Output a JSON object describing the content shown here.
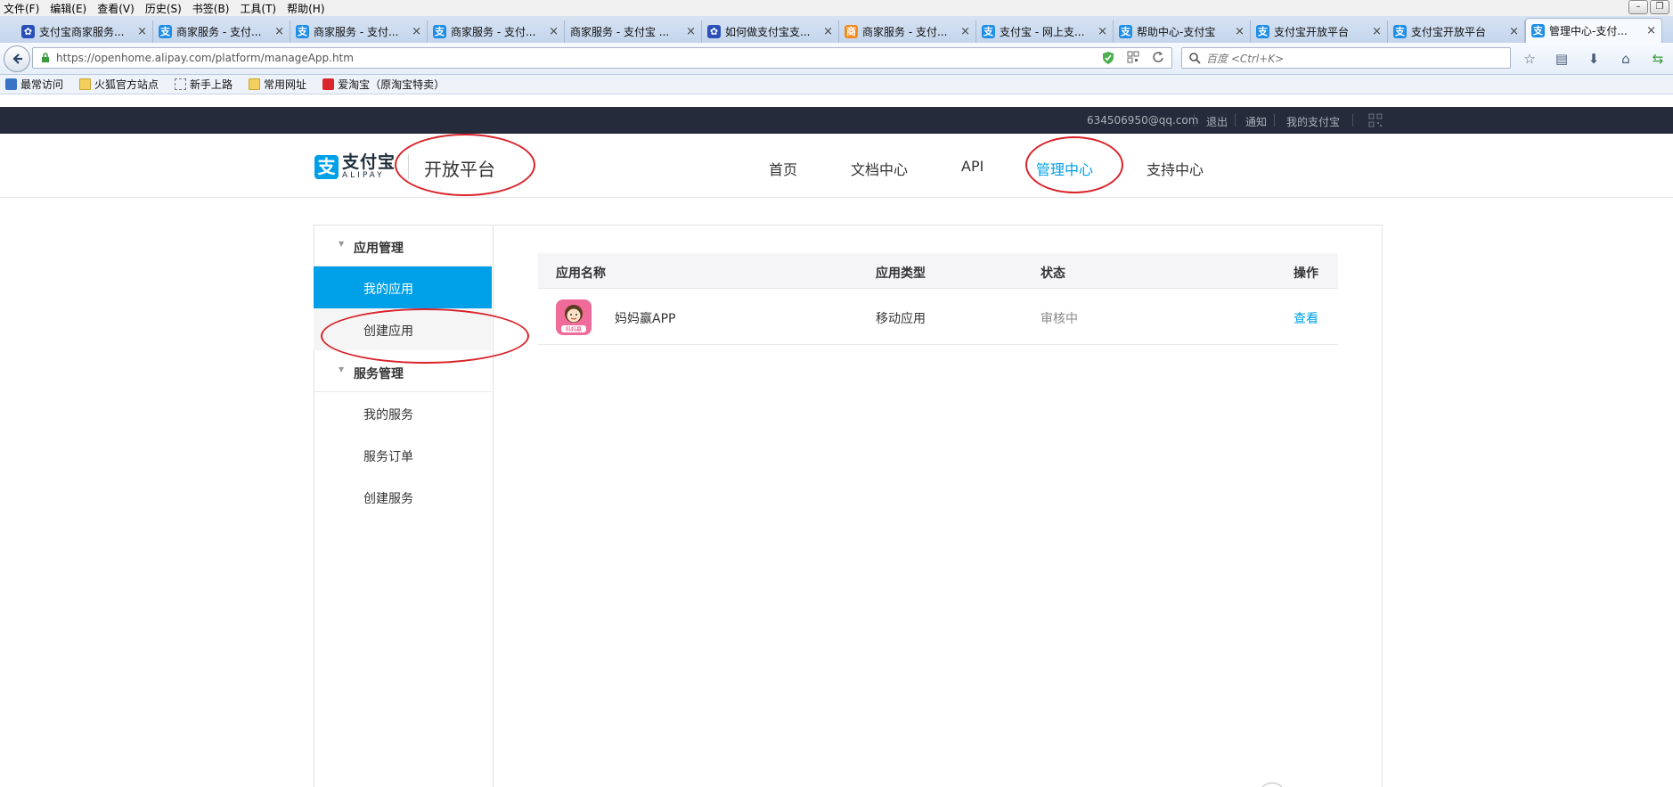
{
  "menubar": [
    "文件(F)",
    "编辑(E)",
    "查看(V)",
    "历史(S)",
    "书签(B)",
    "工具(T)",
    "帮助(H)"
  ],
  "tabs": [
    {
      "title": "支付宝商家服务...",
      "icon": "paw"
    },
    {
      "title": "商家服务 - 支付...",
      "icon": "alipay"
    },
    {
      "title": "商家服务 - 支付...",
      "icon": "alipay"
    },
    {
      "title": "商家服务 - 支付...",
      "icon": "alipay"
    },
    {
      "title": "商家服务 - 支付宝 ...",
      "icon": "none"
    },
    {
      "title": "如何做支付宝支...",
      "icon": "paw"
    },
    {
      "title": "商家服务 - 支付...",
      "icon": "orange"
    },
    {
      "title": "支付宝 - 网上支...",
      "icon": "alipay"
    },
    {
      "title": "帮助中心-支付宝",
      "icon": "alipay"
    },
    {
      "title": "支付宝开放平台",
      "icon": "alipay"
    },
    {
      "title": "支付宝开放平台",
      "icon": "alipay"
    },
    {
      "title": "管理中心-支付...",
      "icon": "alipay",
      "active": true
    }
  ],
  "address": {
    "url": "https://openhome.alipay.com/platform/manageApp.htm",
    "search_placeholder": "百度 <Ctrl+K>"
  },
  "bookmarks": [
    "最常访问",
    "火狐官方站点",
    "新手上路",
    "常用网址",
    "爱淘宝（原淘宝特卖）"
  ],
  "topbar": {
    "email": "634506950@qq.com",
    "logout": "退出",
    "notice": "通知",
    "my_alipay": "我的支付宝"
  },
  "header": {
    "logo_cn": "支付宝",
    "logo_en": "ALIPAY",
    "platform": "开放平台",
    "nav": [
      "首页",
      "文档中心",
      "API",
      "管理中心",
      "支持中心"
    ],
    "active_nav": "管理中心"
  },
  "sidebar": {
    "app_group": "应用管理",
    "my_apps": "我的应用",
    "create_app": "创建应用",
    "service_group": "服务管理",
    "my_services": "我的服务",
    "service_orders": "服务订单",
    "create_service": "创建服务"
  },
  "table": {
    "headers": {
      "name": "应用名称",
      "type": "应用类型",
      "status": "状态",
      "action": "操作"
    },
    "rows": [
      {
        "icon_label": "妈妈赢",
        "name": "妈妈赢APP",
        "type": "移动应用",
        "status": "审核中",
        "action": "查看"
      }
    ]
  },
  "colors": {
    "accent": "#00a0e9",
    "topbar": "#252b3a",
    "annotation": "#d8232a"
  }
}
